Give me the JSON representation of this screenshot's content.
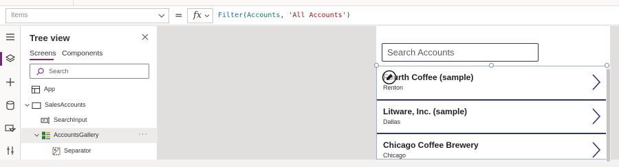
{
  "formula_bar": {
    "property": "Items",
    "equals": "=",
    "fx_label": "fx",
    "formula_fn": "Filter",
    "formula_open": "(",
    "formula_arg1": "Accounts",
    "formula_comma": ", ",
    "formula_arg2": "'All Accounts'",
    "formula_close": ")"
  },
  "left_rail": {
    "icons": [
      "hamburger-menu-icon",
      "layers-icon",
      "plus-icon",
      "database-icon",
      "media-icon",
      "tools-icon"
    ],
    "active_index": 1,
    "accent_color": "#742774"
  },
  "tree_view": {
    "title": "Tree view",
    "tabs": [
      {
        "label": "Screens",
        "active": true
      },
      {
        "label": "Components",
        "active": false
      }
    ],
    "search_placeholder": "Search",
    "nodes": [
      {
        "label": "App",
        "icon": "app-icon"
      },
      {
        "label": "SalesAccounts",
        "icon": "screen-icon",
        "expanded": true
      },
      {
        "label": "SearchInput",
        "icon": "text-input-icon"
      },
      {
        "label": "AccountsGallery",
        "icon": "gallery-icon",
        "expanded": true,
        "selected": true,
        "more": "···"
      },
      {
        "label": "Separator",
        "icon": "separator-icon"
      }
    ]
  },
  "app_preview": {
    "search_placeholder": "Search Accounts",
    "accounts": [
      {
        "name": "Fourth Coffee (sample)",
        "city": "Renton"
      },
      {
        "name": "Litware, Inc. (sample)",
        "city": "Dallas"
      },
      {
        "name": "Chicago Coffee Brewery",
        "city": "Chicago"
      }
    ],
    "accent_color": "#2b3a67"
  }
}
